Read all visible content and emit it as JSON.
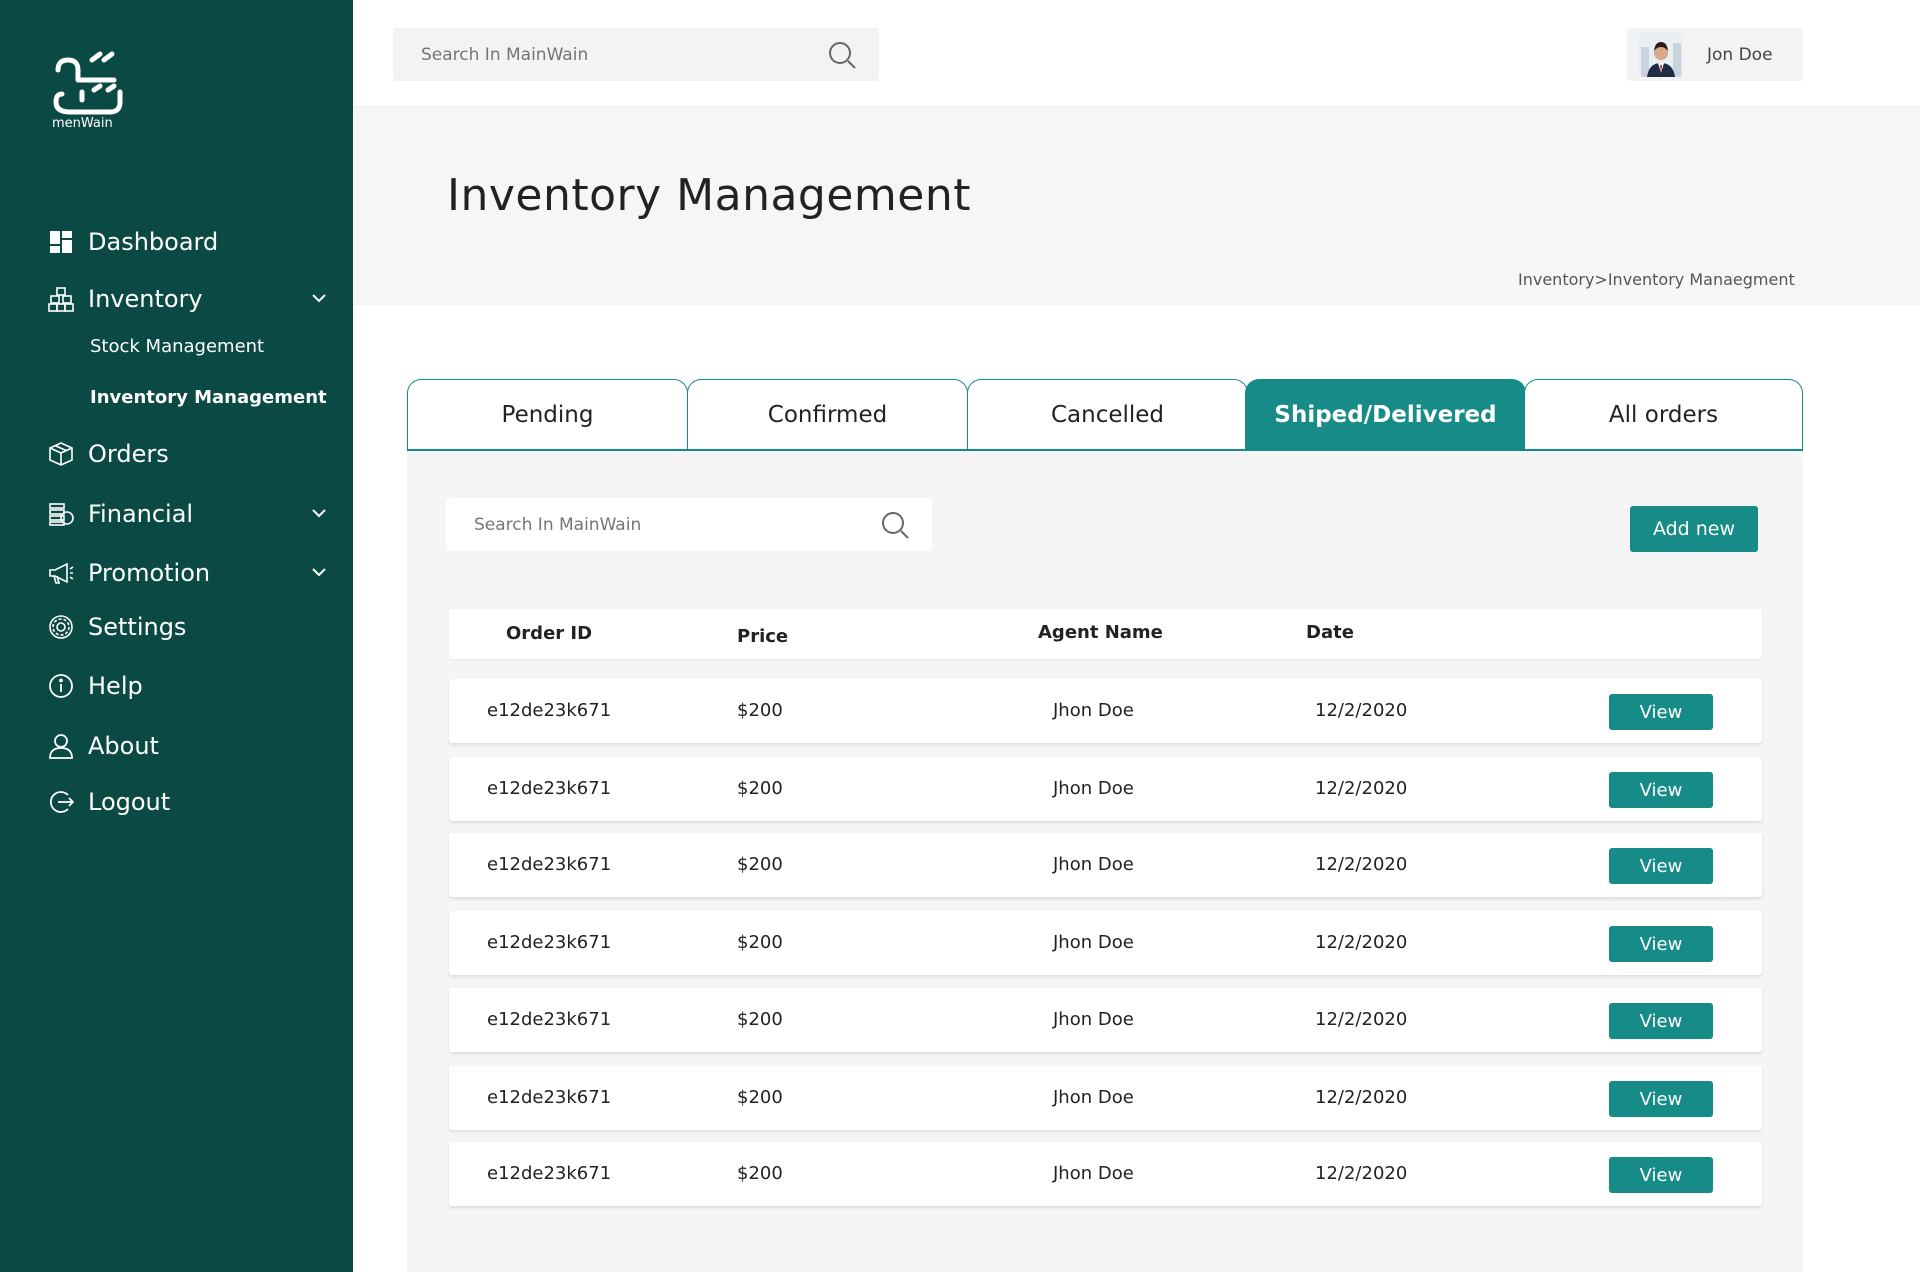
{
  "brand": {
    "logo_text": "menWain"
  },
  "sidebar": {
    "items": [
      {
        "label": "Dashboard",
        "icon": "dashboard-icon"
      },
      {
        "label": "Inventory",
        "icon": "inventory-icon",
        "expanded": true
      },
      {
        "label": "Orders",
        "icon": "orders-icon"
      },
      {
        "label": "Financial",
        "icon": "financial-icon"
      },
      {
        "label": "Promotion",
        "icon": "megaphone-icon"
      },
      {
        "label": "Settings",
        "icon": "gear-icon"
      },
      {
        "label": "Help",
        "icon": "info-icon"
      },
      {
        "label": "About",
        "icon": "user-icon"
      },
      {
        "label": "Logout",
        "icon": "logout-icon"
      }
    ],
    "inventory_sub": [
      {
        "label": "Stock Management"
      },
      {
        "label": "Inventory Management",
        "active": true
      }
    ]
  },
  "topbar": {
    "search_placeholder": "Search In MainWain",
    "user_name": "Jon Doe"
  },
  "header": {
    "title": "Inventory Management",
    "breadcrumb": "Inventory>Inventory Manaegment"
  },
  "tabs": [
    {
      "label": "Pending"
    },
    {
      "label": "Confirmed"
    },
    {
      "label": "Cancelled"
    },
    {
      "label": "Shiped/Delivered",
      "active": true
    },
    {
      "label": "All orders"
    }
  ],
  "content": {
    "search_placeholder": "Search In MainWain",
    "add_button": "Add new"
  },
  "table": {
    "columns": [
      "Order ID",
      "Price",
      "Agent Name",
      "Date"
    ],
    "rows": [
      {
        "order_id": "e12de23k671",
        "price": "$200",
        "agent": "Jhon Doe",
        "date": "12/2/2020",
        "action": "View"
      },
      {
        "order_id": "e12de23k671",
        "price": "$200",
        "agent": "Jhon Doe",
        "date": "12/2/2020",
        "action": "View"
      },
      {
        "order_id": "e12de23k671",
        "price": "$200",
        "agent": "Jhon Doe",
        "date": "12/2/2020",
        "action": "View"
      },
      {
        "order_id": "e12de23k671",
        "price": "$200",
        "agent": "Jhon Doe",
        "date": "12/2/2020",
        "action": "View"
      },
      {
        "order_id": "e12de23k671",
        "price": "$200",
        "agent": "Jhon Doe",
        "date": "12/2/2020",
        "action": "View"
      },
      {
        "order_id": "e12de23k671",
        "price": "$200",
        "agent": "Jhon Doe",
        "date": "12/2/2020",
        "action": "View"
      },
      {
        "order_id": "e12de23k671",
        "price": "$200",
        "agent": "Jhon Doe",
        "date": "12/2/2020",
        "action": "View"
      }
    ]
  },
  "colors": {
    "sidebar_bg": "#0b4a44",
    "accent": "#178b87",
    "panel_bg": "#f5f5f5"
  }
}
